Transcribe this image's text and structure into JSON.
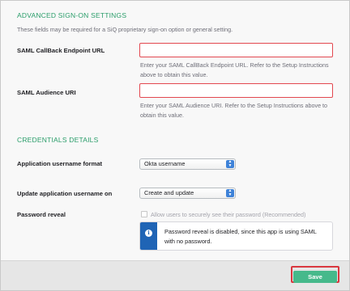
{
  "advanced": {
    "title": "ADVANCED SIGN-ON SETTINGS",
    "subtitle": "These fields may be required for a SiQ proprietary sign-on option or general setting.",
    "callback": {
      "label": "SAML CallBack Endpoint URL",
      "value": "",
      "help": "Enter your SAML CallBack Endpoint URL. Refer to the Setup Instructions above to obtain this value."
    },
    "audience": {
      "label": "SAML Audience URI",
      "value": "",
      "help": "Enter your SAML Audience URI. Refer to the Setup Instructions above to obtain this value."
    }
  },
  "credentials": {
    "title": "CREDENTIALS DETAILS",
    "username_format": {
      "label": "Application username format",
      "selected": "Okta username"
    },
    "update_on": {
      "label": "Update application username on",
      "selected": "Create and update"
    },
    "password_reveal": {
      "label": "Password reveal",
      "checkbox_label": "Allow users to securely see their password (Recommended)",
      "checked": false,
      "info_icon": "info-icon",
      "info_text": "Password reveal is disabled, since this app is using SAML with no password."
    }
  },
  "footer": {
    "save_label": "Save"
  },
  "colors": {
    "section_title": "#2a9d6a",
    "error_border": "#e34850",
    "info_stripe": "#1f64b5",
    "save_button": "#46b98b",
    "stepper": "#3e82d8"
  }
}
